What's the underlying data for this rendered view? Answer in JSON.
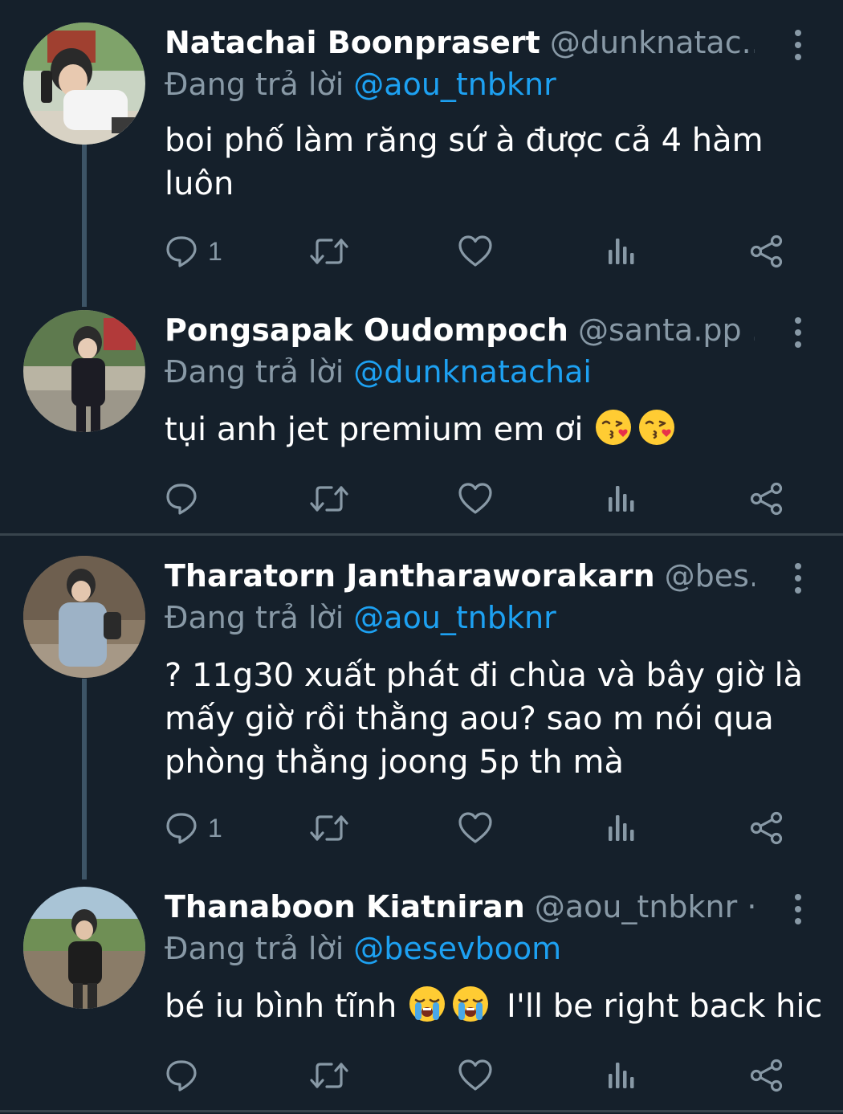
{
  "colors": {
    "background": "#15202b",
    "name": "#ffffff",
    "secondary_text": "#8899a6",
    "mention": "#1da1f2",
    "separator": "#38444d",
    "thread_line": "#3d5466"
  },
  "tweets": [
    {
      "name": "Natachai Boonprasert",
      "handle": "@dunknatac...",
      "replying_label": "Đang trả lời",
      "replying_to": "@aou_tnbknr",
      "text": "boi phố làm răng sứ à được cả 4 hàm luôn",
      "reply_count": "1",
      "icons": [
        "reply-icon",
        "retweet-icon",
        "like-icon",
        "analytics-icon",
        "share-icon",
        "more-icon"
      ]
    },
    {
      "name": "Pongsapak Oudompoch",
      "handle": "@santa.pp ...",
      "replying_label": "Đang trả lời",
      "replying_to": "@dunknatachai",
      "text": "tụi anh jet premium em ơi",
      "emojis": [
        "kissing-heart-emoji",
        "kissing-heart-emoji"
      ],
      "reply_count": "",
      "icons": [
        "reply-icon",
        "retweet-icon",
        "like-icon",
        "analytics-icon",
        "share-icon",
        "more-icon"
      ]
    },
    {
      "name": "Tharatorn Jantharaworakarn",
      "handle": "@bes...",
      "replying_label": "Đang trả lời",
      "replying_to": "@aou_tnbknr",
      "text": "? 11g30 xuất phát đi chùa và bây giờ là mấy giờ rồi thằng aou? sao m nói qua phòng thằng joong 5p th mà",
      "reply_count": "1",
      "icons": [
        "reply-icon",
        "retweet-icon",
        "like-icon",
        "analytics-icon",
        "share-icon",
        "more-icon"
      ]
    },
    {
      "name": "Thanaboon Kiatniran",
      "handle": "@aou_tnbknr ·...",
      "replying_label": "Đang trả lời",
      "replying_to": "@besevboom",
      "text_before": "bé iu bình tĩnh",
      "emojis": [
        "loudly-crying-emoji",
        "loudly-crying-emoji"
      ],
      "text_after": "I'll be right back hic",
      "reply_count": "",
      "icons": [
        "reply-icon",
        "retweet-icon",
        "like-icon",
        "analytics-icon",
        "share-icon",
        "more-icon"
      ]
    }
  ]
}
